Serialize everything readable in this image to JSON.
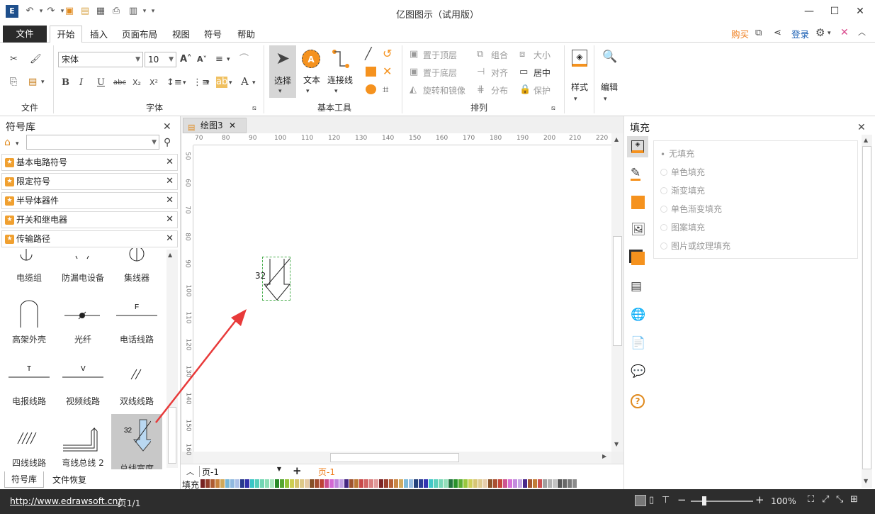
{
  "app": {
    "title": "亿图图示（试用版）"
  },
  "menu": {
    "file": "文件",
    "items": [
      "开始",
      "插入",
      "页面布局",
      "视图",
      "符号",
      "帮助"
    ],
    "buy": "购买",
    "login": "登录"
  },
  "ribbon": {
    "groups": {
      "file": "文件",
      "font": "字体",
      "basic_tools": "基本工具",
      "arrange": "排列"
    },
    "font_name": "宋体",
    "font_size": "10",
    "tools": {
      "select": "选择",
      "text": "文本",
      "connector": "连接线"
    },
    "arrange": {
      "bring_front": "置于顶层",
      "send_back": "置于底层",
      "rotate_mirror": "旋转和镜像",
      "group": "组合",
      "align": "对齐",
      "distribute": "分布",
      "size": "大小",
      "center": "居中",
      "protect": "保护"
    },
    "style": "样式",
    "edit": "编辑"
  },
  "library": {
    "title": "符号库",
    "categories": [
      "基本电路符号",
      "限定符号",
      "半导体器件",
      "开关和继电器",
      "传输路径"
    ],
    "symbols": [
      "电缆组",
      "防漏电设备",
      "集线器",
      "高架外壳",
      "光纤",
      "电话线路",
      "电报线路",
      "视频线路",
      "双线线路",
      "四线线路",
      "弯线总线 2",
      "总线宽度"
    ],
    "symbol_marks": {
      "phone": "F",
      "telegraph": "T",
      "video": "V",
      "bus_width": "32"
    },
    "tabs": [
      "符号库",
      "文件恢复"
    ]
  },
  "document": {
    "tab": "绘图3",
    "hruler": [
      "70",
      "80",
      "90",
      "100",
      "110",
      "120",
      "130",
      "140",
      "150",
      "160",
      "170",
      "180",
      "190",
      "200",
      "210",
      "220"
    ],
    "vruler": [
      "50",
      "60",
      "70",
      "80",
      "90",
      "100",
      "110",
      "120",
      "130",
      "140",
      "150",
      "160"
    ],
    "shape_label": "32",
    "page_selector": "页-1",
    "page_tab": "页-1",
    "fill_label": "填充"
  },
  "fill": {
    "title": "填充",
    "options": [
      "无填充",
      "单色填充",
      "渐变填充",
      "单色渐变填充",
      "图案填充",
      "图片或纹理填充"
    ]
  },
  "status": {
    "url": "http://www.edrawsoft.cn/",
    "page": "页1/1",
    "zoom": "100%"
  },
  "colors": {
    "accent": "#ef7c1a",
    "arrow": "#e83a3a",
    "statusbar": "#2d2d2d"
  }
}
